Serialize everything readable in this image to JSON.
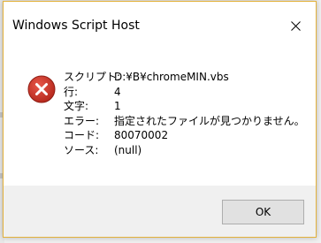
{
  "window": {
    "title": "Windows Script Host"
  },
  "message": {
    "icon": "error-icon",
    "rows": [
      {
        "label": "スクリプト:",
        "value": "D:¥B¥chromeMIN.vbs"
      },
      {
        "label": "行:",
        "value": "4"
      },
      {
        "label": "文字:",
        "value": "1"
      },
      {
        "label": "エラー:",
        "value": "指定されたファイルが見つかりません。"
      },
      {
        "label": "コード:",
        "value": "80070002"
      },
      {
        "label": "ソース:",
        "value": "(null)"
      }
    ]
  },
  "buttons": {
    "ok_label": "OK"
  },
  "colors": {
    "border_accent": "#e3b23c",
    "error_red": "#c42b1c",
    "footer_bg": "#f0f0f0",
    "button_bg": "#e1e1e1"
  }
}
